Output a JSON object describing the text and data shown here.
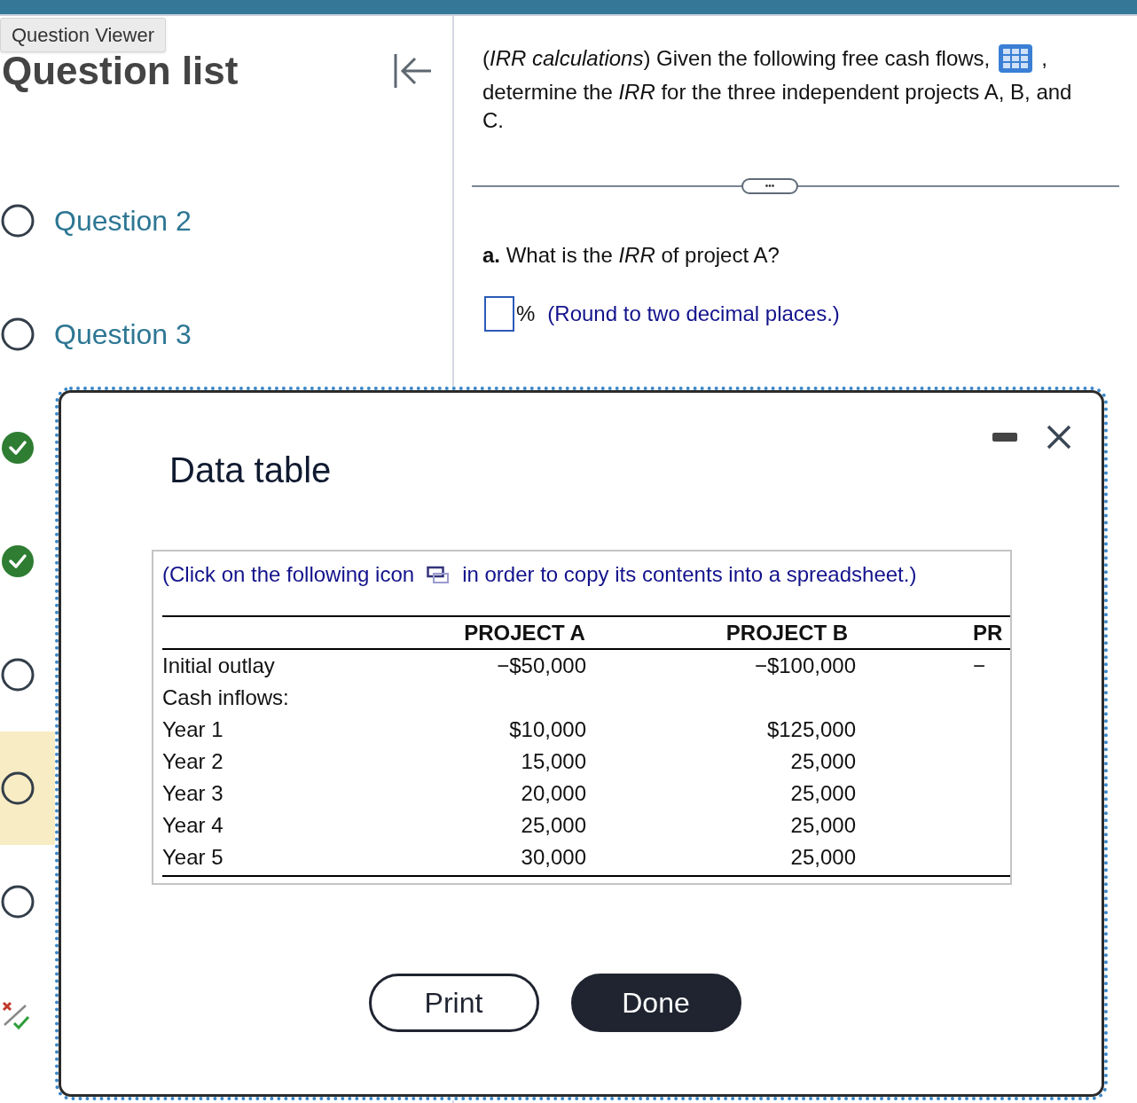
{
  "tooltip": "Question Viewer",
  "sidebar": {
    "title": "Question list",
    "items": [
      {
        "label": "Question 2",
        "kind": "unanswered",
        "selected": false
      },
      {
        "label": "Question 3",
        "kind": "unanswered",
        "selected": false
      },
      {
        "kind": "correct",
        "selected": false
      },
      {
        "kind": "correct",
        "selected": false
      },
      {
        "kind": "unanswered",
        "selected": false
      },
      {
        "kind": "unanswered",
        "selected": true
      },
      {
        "kind": "unanswered",
        "selected": false
      },
      {
        "kind": "partial",
        "selected": false
      }
    ]
  },
  "question": {
    "intro_1": "(*IRR calculations*) Given the following free cash flows,",
    "intro_sep": ",",
    "intro_2": "determine the *IRR* for the three independent projects A, B, and C.",
    "more_button": "•••",
    "part": "**a.** What is the *IRR* of project A?",
    "unit": "%",
    "hint": "(Round to two decimal places.)"
  },
  "dialog": {
    "title": "Data table",
    "instruction_1": "(Click on the following icon",
    "instruction_2": "in order to copy its contents into a spreadsheet.)",
    "columns": [
      "PROJECT A",
      "PROJECT B",
      "PR"
    ],
    "rows": [
      {
        "label": "Initial outlay",
        "cells": [
          "−$50,000",
          "−$100,000",
          "−"
        ]
      },
      {
        "label": "Cash inflows:",
        "cells": []
      },
      {
        "label": "Year 1",
        "cells": [
          "$10,000",
          "$125,000"
        ]
      },
      {
        "label": "Year 2",
        "cells": [
          "15,000",
          "25,000"
        ]
      },
      {
        "label": "Year 3",
        "cells": [
          "20,000",
          "25,000"
        ]
      },
      {
        "label": "Year 4",
        "cells": [
          "25,000",
          "25,000"
        ]
      },
      {
        "label": "Year 5",
        "cells": [
          "30,000",
          "25,000"
        ]
      }
    ],
    "buttons": [
      {
        "label": "Print",
        "kind": "outline"
      },
      {
        "label": "Done",
        "kind": "filled"
      }
    ]
  }
}
